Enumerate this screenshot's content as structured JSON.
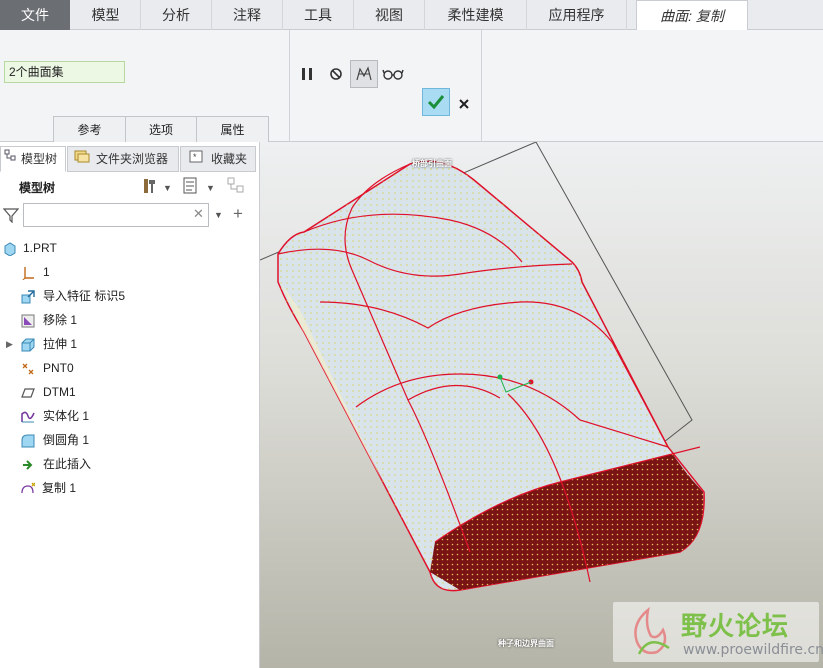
{
  "tabs": [
    {
      "label": "文件",
      "kind": "file"
    },
    {
      "label": "模型"
    },
    {
      "label": "分析"
    },
    {
      "label": "注释"
    },
    {
      "label": "工具"
    },
    {
      "label": "视图"
    },
    {
      "label": "柔性建模"
    },
    {
      "label": "应用程序"
    },
    {
      "label": "曲面: 复制",
      "kind": "active"
    }
  ],
  "dashboard": {
    "collector_value": "2个曲面集",
    "subtabs": [
      "参考",
      "选项",
      "属性"
    ],
    "tools": {
      "pause": "pause-icon",
      "no_preview": "no-preview-icon",
      "verify": "verify-preview-icon",
      "glasses": "glasses-icon",
      "ok": "check-icon",
      "cancel": "cancel-icon"
    }
  },
  "left_panel": {
    "tabs": [
      "模型树",
      "文件夹浏览器",
      "收藏夹"
    ],
    "title": "模型树",
    "tree": [
      {
        "label": "1.PRT",
        "icon": "part-icon",
        "level": 0
      },
      {
        "label": "1",
        "icon": "csys-icon",
        "level": 1
      },
      {
        "label": "导入特征 标识5",
        "icon": "import-feature-icon",
        "level": 1
      },
      {
        "label": "移除 1",
        "icon": "remove-icon",
        "level": 1
      },
      {
        "label": "拉伸 1",
        "icon": "extrude-icon",
        "level": 1,
        "expandable": true
      },
      {
        "label": "PNT0",
        "icon": "datum-point-icon",
        "level": 1
      },
      {
        "label": "DTM1",
        "icon": "datum-plane-icon",
        "level": 1
      },
      {
        "label": "实体化 1",
        "icon": "solidify-icon",
        "level": 1
      },
      {
        "label": "倒圆角 1",
        "icon": "round-icon",
        "level": 1
      },
      {
        "label": "在此插入",
        "icon": "insert-here-icon",
        "level": 1
      },
      {
        "label": "复制 1",
        "icon": "copy-surface-icon",
        "level": 1
      }
    ]
  },
  "viewport": {
    "label_top": "桥部引曲面",
    "label_bottom": "种子和边界曲面",
    "watermark": {
      "name": "野火论坛",
      "url": "www.proewildfire.cn"
    }
  },
  "colors": {
    "accent": "#a9dcf3",
    "surface_fill": "#d8e3ea",
    "edge_red": "#e0102a",
    "dark_surface": "#7a1414",
    "mesh_yellow": "#e8e04a"
  }
}
